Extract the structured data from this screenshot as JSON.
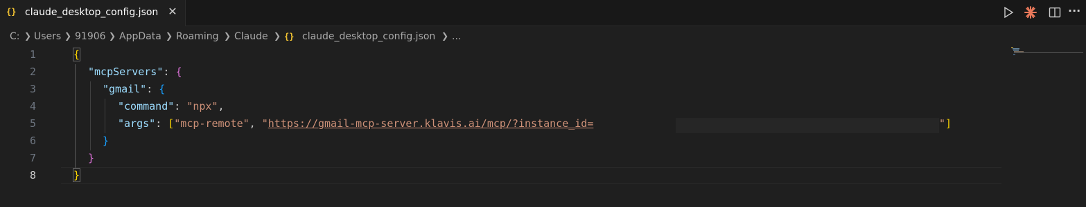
{
  "tab": {
    "icon": "{}",
    "label": "claude_desktop_config.json",
    "close": "✕"
  },
  "actions": {
    "run_icon": "play-icon",
    "claude_icon": "claude-asterisk-icon",
    "split_icon": "split-editor-icon",
    "more": "···"
  },
  "breadcrumb": {
    "items": [
      "C:",
      "Users",
      "91906",
      "AppData",
      "Roaming",
      "Claude",
      "claude_desktop_config.json",
      "..."
    ],
    "file_icon": "{}"
  },
  "editor": {
    "line_numbers": [
      "1",
      "2",
      "3",
      "4",
      "5",
      "6",
      "7",
      "8"
    ],
    "active_line": "8",
    "tokens": {
      "l1_open": "{",
      "l2_key": "\"mcpServers\"",
      "l2_colon": ": ",
      "l2_open": "{",
      "l3_key": "\"gmail\"",
      "l3_colon": ": ",
      "l3_open": "{",
      "l4_key": "\"command\"",
      "l4_colon": ": ",
      "l4_val": "\"npx\"",
      "l4_comma": ",",
      "l5_key": "\"args\"",
      "l5_colon": ": ",
      "l5_open": "[",
      "l5_val1": "\"mcp-remote\"",
      "l5_comma": ", ",
      "l5_quote": "\"",
      "l5_url": "https://gmail-mcp-server.klavis.ai/mcp/?instance_id=",
      "l5_endquote": "\"",
      "l5_close": "]",
      "l6_close": "}",
      "l7_close": "}",
      "l8_close": "}"
    }
  },
  "colors": {
    "background": "#1f1f1f",
    "key": "#9cdcfe",
    "string": "#ce9178",
    "bracket_gold": "#ffd700",
    "bracket_orchid": "#da70d6",
    "bracket_blue": "#179fff"
  }
}
